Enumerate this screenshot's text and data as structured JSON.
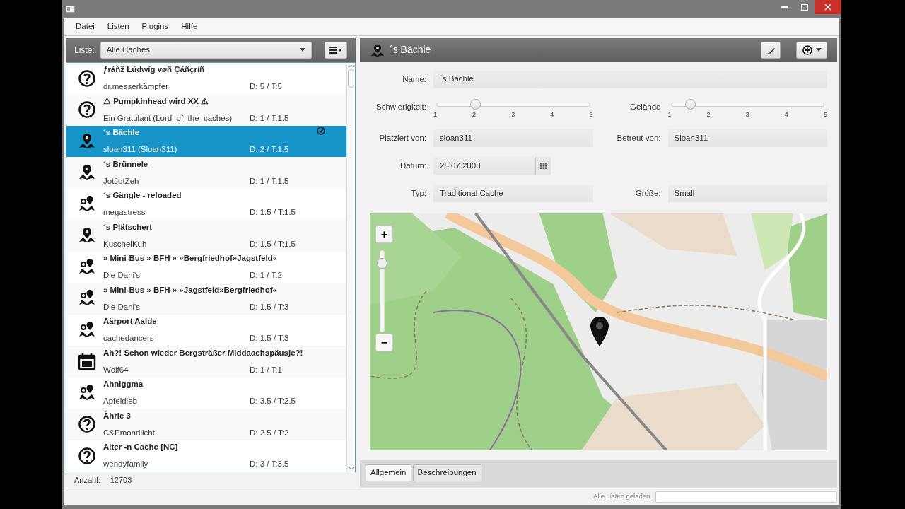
{
  "menu": [
    "Datei",
    "Listen",
    "Plugins",
    "Hilfe"
  ],
  "list_toolbar": {
    "label": "Liste:",
    "combo_value": "Alle Caches"
  },
  "caches": [
    {
      "kind": "unknown",
      "title": "ƒráñž Łúdwíg vøñ Çáñçríñ",
      "owner": "dr.messerkämpfer",
      "rating": "D: 5 / T:5",
      "selected": false,
      "marked": false
    },
    {
      "kind": "unknown",
      "title": "⚠ Pumpkinhead wird XX ⚠",
      "owner": "Ein Gratulant (Lord_of_the_caches)",
      "rating": "D: 1 / T:1.5",
      "selected": false,
      "marked": false
    },
    {
      "kind": "traditional",
      "title": "´s Bächle",
      "owner": "sloan311 (Sloan311)",
      "rating": "D: 2 / T:1.5",
      "selected": true,
      "marked": true
    },
    {
      "kind": "traditional",
      "title": "´s Brünnele",
      "owner": "JotJotZeh",
      "rating": "D: 1 / T:1.5",
      "selected": false,
      "marked": false
    },
    {
      "kind": "multi",
      "title": "´s Gängle - reloaded",
      "owner": "megastress",
      "rating": "D: 1.5 / T:1.5",
      "selected": false,
      "marked": false
    },
    {
      "kind": "traditional",
      "title": "´s Plätschert",
      "owner": "KuschelKuh",
      "rating": "D: 1.5 / T:1.5",
      "selected": false,
      "marked": false
    },
    {
      "kind": "multi",
      "title": "» Mini-Bus » BFH » »Bergfriedhof»Jagstfeld«",
      "owner": "Die Dani's",
      "rating": "D: 1 / T:2",
      "selected": false,
      "marked": false
    },
    {
      "kind": "multi",
      "title": "» Mini-Bus » BFH » »Jagstfeld»Bergfriedhof«",
      "owner": "Die Dani's",
      "rating": "D: 1.5 / T:3",
      "selected": false,
      "marked": false
    },
    {
      "kind": "multi",
      "title": "Äärport Aalde",
      "owner": "cachedancers",
      "rating": "D: 1.5 / T:3",
      "selected": false,
      "marked": false
    },
    {
      "kind": "event",
      "title": "Äh?! Schon wieder Bergsträßer Middaachspäusje?!",
      "owner": "Wolf64",
      "rating": "D: 1 / T:1",
      "selected": false,
      "marked": false
    },
    {
      "kind": "multi",
      "title": "Ähniggma",
      "owner": "Apfeldieb",
      "rating": "D: 3.5 / T:2.5",
      "selected": false,
      "marked": false
    },
    {
      "kind": "unknown",
      "title": "Ährle 3",
      "owner": "C&Pmondlicht",
      "rating": "D: 2.5 / T:2",
      "selected": false,
      "marked": false
    },
    {
      "kind": "unknown",
      "title": "Älter -n Cache [NC]",
      "owner": "wendyfamily",
      "rating": "D: 3 / T:3.5",
      "selected": false,
      "marked": false
    }
  ],
  "count": {
    "label": "Anzahl:",
    "value": "12703"
  },
  "detail": {
    "title": "´s Bächle",
    "name": {
      "label": "Name:",
      "value": "´s Bächle"
    },
    "sliders": [
      {
        "label": "Schwierigkeit:",
        "level": 0.25,
        "ticks": [
          "1",
          "2",
          "3",
          "4",
          "5"
        ]
      },
      {
        "label": "Gelände",
        "level": 0.125,
        "ticks": [
          "1",
          "2",
          "3",
          "4",
          "5"
        ]
      }
    ],
    "fields": [
      {
        "label": "Platziert von:",
        "value": "sloan311"
      },
      {
        "label": "Betreut von:",
        "value": "Sloan311"
      }
    ],
    "date": {
      "label": "Datum:",
      "value": "28.07.2008"
    },
    "fields2": [
      {
        "label": "Typ:",
        "value": "Traditional Cache"
      },
      {
        "label": "Größe:",
        "value": "Small"
      }
    ],
    "map": {
      "zoom_in": "+",
      "zoom_out": "−",
      "zoom_slider": {
        "level": 0.85
      }
    },
    "tabs": [
      {
        "label": "Allgemein",
        "selected": true
      },
      {
        "label": "Beschreibungen",
        "selected": false
      }
    ]
  },
  "status_bar": {
    "message": "Alle Listen geladen.",
    "progress": {
      "level": 0
    }
  }
}
